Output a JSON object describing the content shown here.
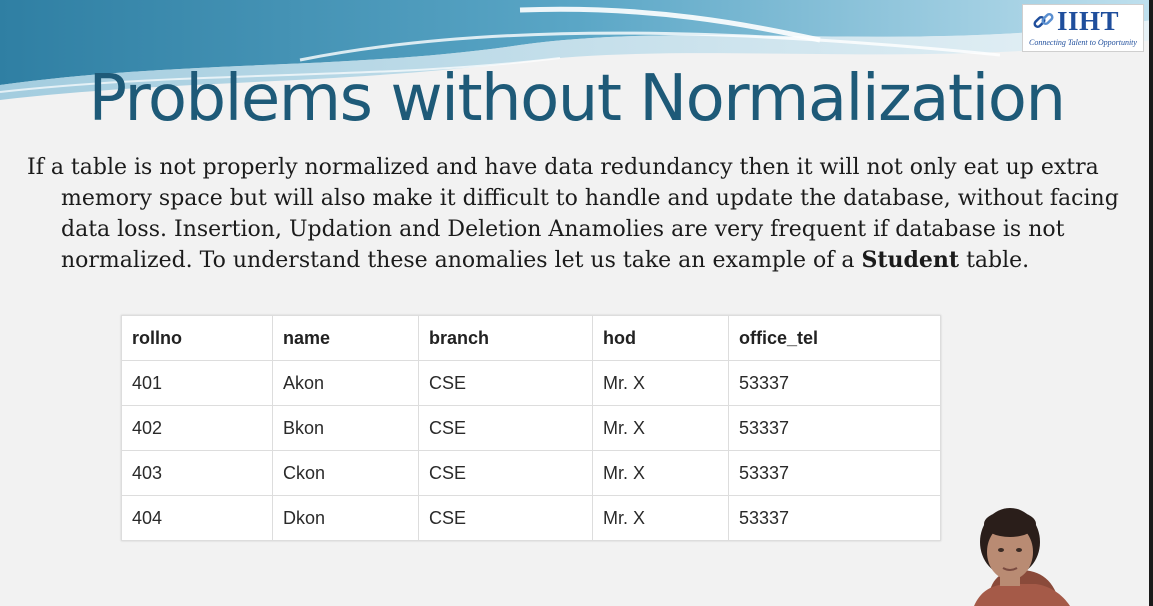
{
  "logo": {
    "text": "IIHT",
    "tagline": "Connecting Talent to Opportunity",
    "icon": "chain-link-icon",
    "color": "#1f4e9c"
  },
  "title": "Problems without Normalization",
  "paragraph": {
    "lines": [
      "If a table is not properly normalized and have data redundancy then it will not only eat up extra",
      "memory space but will also make it difficult to handle and update the database, without facing",
      "data loss. Insertion, Updation and Deletion Anamolies are very frequent if database is not"
    ],
    "last_line_before": "normalized. To understand these anomalies let us take an example of a ",
    "last_line_bold": "Student",
    "last_line_after": " table."
  },
  "table": {
    "headers": [
      "rollno",
      "name",
      "branch",
      "hod",
      "office_tel"
    ],
    "rows": [
      [
        "401",
        "Akon",
        "CSE",
        "Mr. X",
        "53337"
      ],
      [
        "402",
        "Bkon",
        "CSE",
        "Mr. X",
        "53337"
      ],
      [
        "403",
        "Ckon",
        "CSE",
        "Mr. X",
        "53337"
      ],
      [
        "404",
        "Dkon",
        "CSE",
        "Mr. X",
        "53337"
      ]
    ]
  },
  "colors": {
    "title": "#1e5a78",
    "wave_dark": "#1e6f8f",
    "wave_light": "#9cc8db"
  }
}
